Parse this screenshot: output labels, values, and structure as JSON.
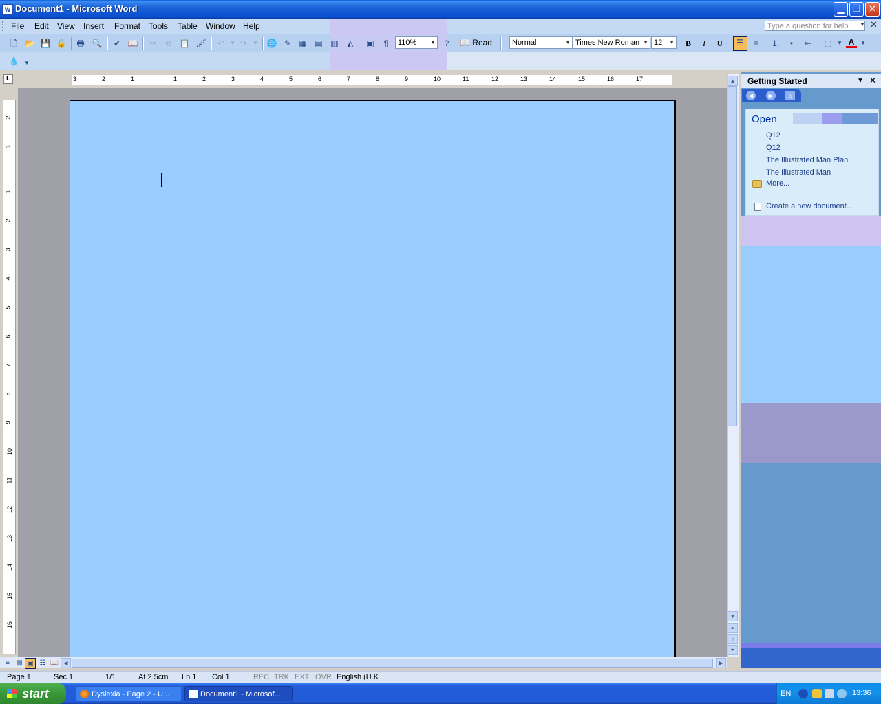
{
  "window": {
    "title": "Document1 - Microsoft Word"
  },
  "menu": {
    "items": [
      "File",
      "Edit",
      "View",
      "Insert",
      "Format",
      "Tools",
      "Table",
      "Window",
      "Help"
    ],
    "help_placeholder": "Type a question for help"
  },
  "toolbar": {
    "zoom": "110%",
    "read_label": "Read",
    "style": "Normal",
    "font": "Times New Roman",
    "size": "12",
    "bold": "B",
    "italic": "I",
    "underline": "U",
    "font_color_label": "A"
  },
  "ruler": {
    "h_labels": [
      "3",
      "2",
      "1",
      "1",
      "2",
      "3",
      "4",
      "5",
      "6",
      "7",
      "8",
      "9",
      "10",
      "11",
      "12",
      "13",
      "14",
      "15",
      "16",
      "17"
    ],
    "v_labels": [
      "2",
      "1",
      "1",
      "2",
      "3",
      "4",
      "5",
      "6",
      "7",
      "8",
      "9",
      "10",
      "11",
      "12",
      "13",
      "14",
      "15",
      "16"
    ]
  },
  "taskpane": {
    "title": "Getting Started",
    "open_heading": "Open",
    "recent_files": [
      "Q12",
      "Q12",
      "The Illustrated Man Plan",
      "The Illustrated Man"
    ],
    "more_label": "More...",
    "create_label": "Create a new document..."
  },
  "status": {
    "page": "Page  1",
    "section": "Sec  1",
    "pages": "1/1",
    "at": "At  2.5cm",
    "line": "Ln  1",
    "col": "Col  1",
    "rec": "REC",
    "trk": "TRK",
    "ext": "EXT",
    "ovr": "OVR",
    "language": "English (U.K"
  },
  "taskbar": {
    "start_label": "start",
    "tasks": [
      "Dyslexia - Page 2 - U...",
      "Document1 - Microsof..."
    ],
    "tray_lang": "EN",
    "clock": "13:36"
  },
  "colors": {
    "page_background": "#99ccff",
    "title_bar": "#0c4fcf",
    "taskbar": "#245edb"
  }
}
